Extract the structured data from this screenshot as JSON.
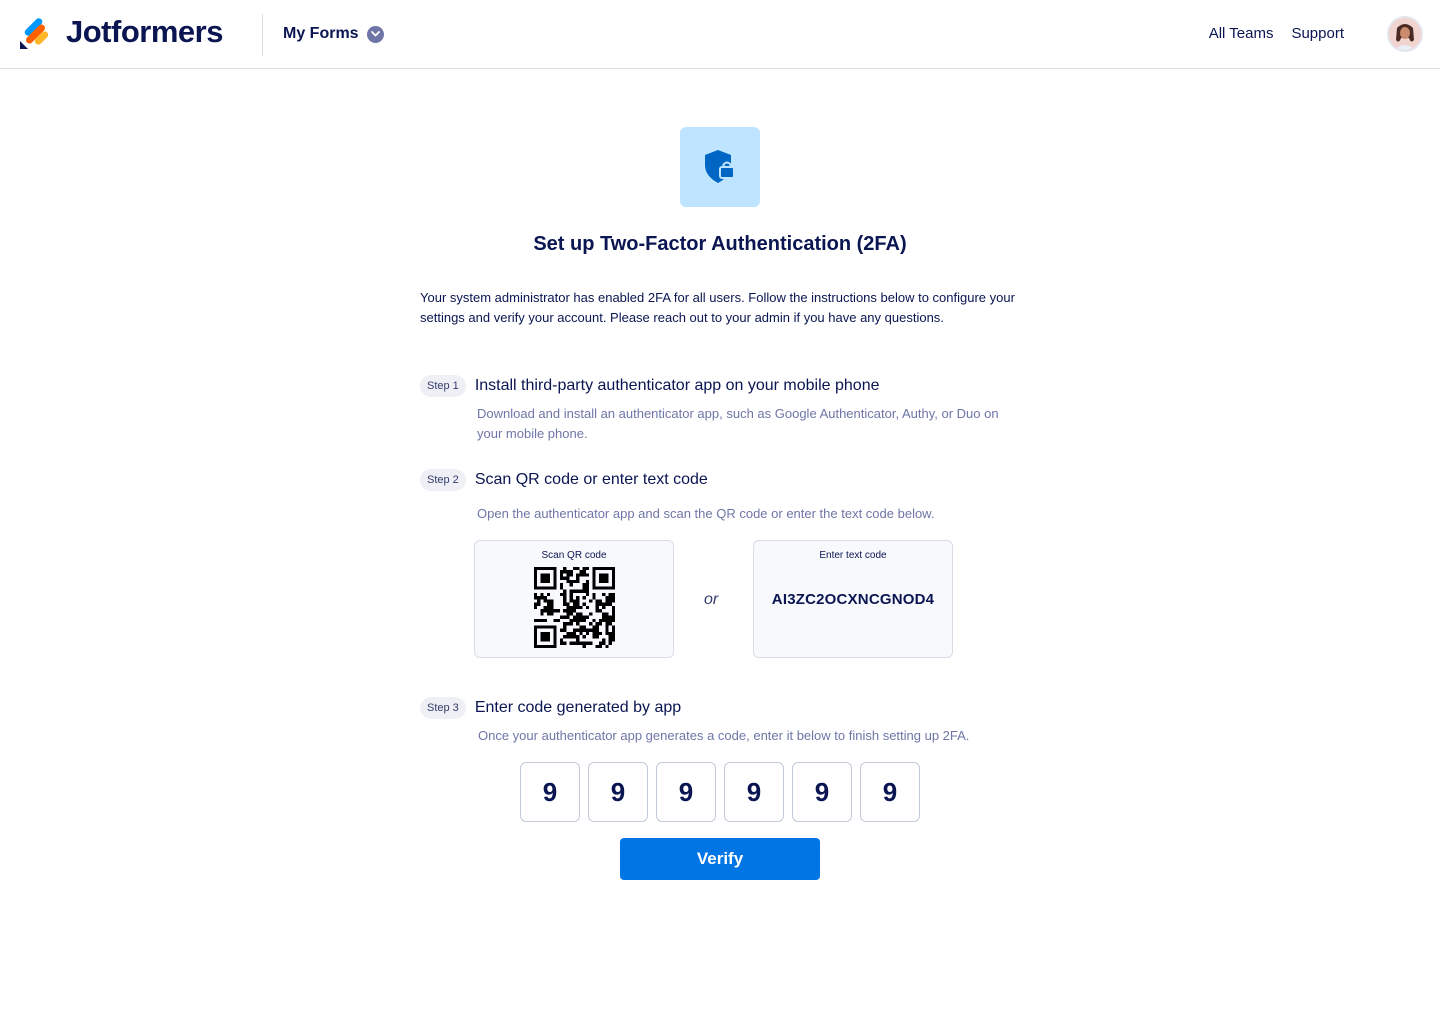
{
  "header": {
    "brand": "Jotformers",
    "my_forms": "My Forms",
    "nav": {
      "all_teams": "All Teams",
      "support": "Support"
    },
    "logo_colors": [
      "#0099ff",
      "#ff6100",
      "#ffb629",
      "#0a1551"
    ]
  },
  "hero": {
    "icon": "shield-lock-icon",
    "title": "Set up Two-Factor Authentication (2FA)",
    "intro": "Your system administrator has enabled 2FA for all users. Follow the instructions below to configure your settings and verify your account. Please reach out to your admin if you have any questions."
  },
  "steps": [
    {
      "badge": "Step 1",
      "title": "Install third-party authenticator app on your mobile phone",
      "desc": "Download and install an authenticator app, such as Google Authenticator, Authy, or Duo on your mobile phone."
    },
    {
      "badge": "Step 2",
      "title": "Scan QR code or enter text code",
      "desc": "Open the authenticator app and scan the QR code or enter the text code below."
    },
    {
      "badge": "Step 3",
      "title": "Enter code generated by app",
      "desc": "Once your authenticator app generates a code, enter it below to finish setting up 2FA."
    }
  ],
  "qr_box": {
    "label": "Scan QR code"
  },
  "separator": "or",
  "text_box": {
    "label": "Enter text code",
    "code": "AI3ZC2OCXNCGNOD4"
  },
  "otp_digits": [
    "9",
    "9",
    "9",
    "9",
    "9",
    "9"
  ],
  "verify_label": "Verify",
  "colors": {
    "primary": "#0075e3",
    "navy": "#0a1551",
    "muted": "#6f76a7",
    "tile": "#bfe4ff"
  }
}
